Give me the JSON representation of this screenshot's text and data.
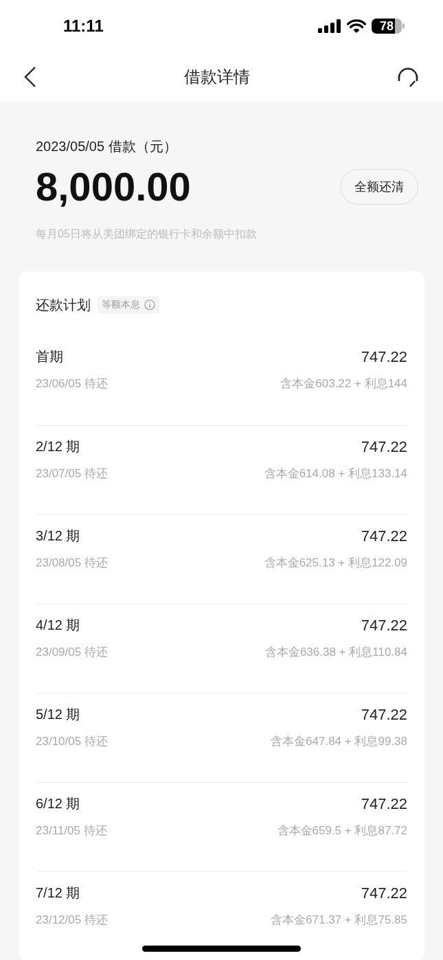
{
  "status_bar": {
    "time": "11:11",
    "battery": "78"
  },
  "nav": {
    "title": "借款详情"
  },
  "loan": {
    "label": "2023/05/05 借款（元）",
    "amount": "8,000.00",
    "payoff_button": "全额还清",
    "note": "每月05日将从美团绑定的银行卡和余额中扣款"
  },
  "plan": {
    "title": "还款计划",
    "method": "等额本息",
    "rows": [
      {
        "period": "首期",
        "amount": "747.22",
        "date": "23/06/05 待还",
        "breakdown": "含本金603.22 + 利息144"
      },
      {
        "period": "2/12 期",
        "amount": "747.22",
        "date": "23/07/05 待还",
        "breakdown": "含本金614.08 + 利息133.14"
      },
      {
        "period": "3/12 期",
        "amount": "747.22",
        "date": "23/08/05 待还",
        "breakdown": "含本金625.13 + 利息122.09"
      },
      {
        "period": "4/12 期",
        "amount": "747.22",
        "date": "23/09/05 待还",
        "breakdown": "含本金636.38 + 利息110.84"
      },
      {
        "period": "5/12 期",
        "amount": "747.22",
        "date": "23/10/05 待还",
        "breakdown": "含本金647.84 + 利息99.38"
      },
      {
        "period": "6/12 期",
        "amount": "747.22",
        "date": "23/11/05 待还",
        "breakdown": "含本金659.5 + 利息87.72"
      },
      {
        "period": "7/12 期",
        "amount": "747.22",
        "date": "23/12/05 待还",
        "breakdown": "含本金671.37 + 利息75.85"
      }
    ]
  }
}
